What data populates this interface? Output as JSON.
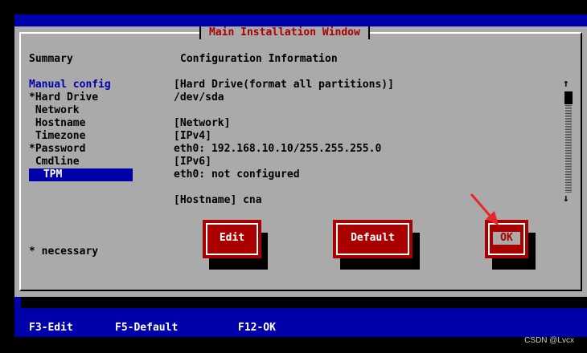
{
  "window": {
    "title": "Main Installation Window"
  },
  "headers": {
    "summary": "Summary",
    "configuration": "Configuration Information"
  },
  "menu": {
    "items": [
      {
        "label": "Manual config"
      },
      {
        "label": "*Hard Drive"
      },
      {
        "label": " Network"
      },
      {
        "label": " Hostname"
      },
      {
        "label": " Timezone"
      },
      {
        "label": "*Password"
      },
      {
        "label": " Cmdline"
      },
      {
        "label": " TPM"
      }
    ]
  },
  "info": {
    "lines": [
      "[Hard Drive(format all partitions)]",
      "/dev/sda",
      "",
      "[Network]",
      "[IPv4]",
      "eth0: 192.168.10.10/255.255.255.0",
      "[IPv6]",
      "eth0: not configured",
      "",
      "[Hostname] cna"
    ]
  },
  "scrollbar": {
    "up_arrow": "↑",
    "down_arrow": "↓"
  },
  "buttons": {
    "edit": "Edit",
    "default": "Default",
    "ok": "OK"
  },
  "note": "* necessary",
  "hotkeys": {
    "edit": "F3-Edit",
    "default": "F5-Default",
    "ok": "F12-OK"
  },
  "watermark": "CSDN @Lvcx",
  "colors": {
    "background": "#0000aa",
    "window": "#aaaaaa",
    "title": "#aa0000",
    "button": "#aa0000",
    "arrow": "#e8262a"
  }
}
